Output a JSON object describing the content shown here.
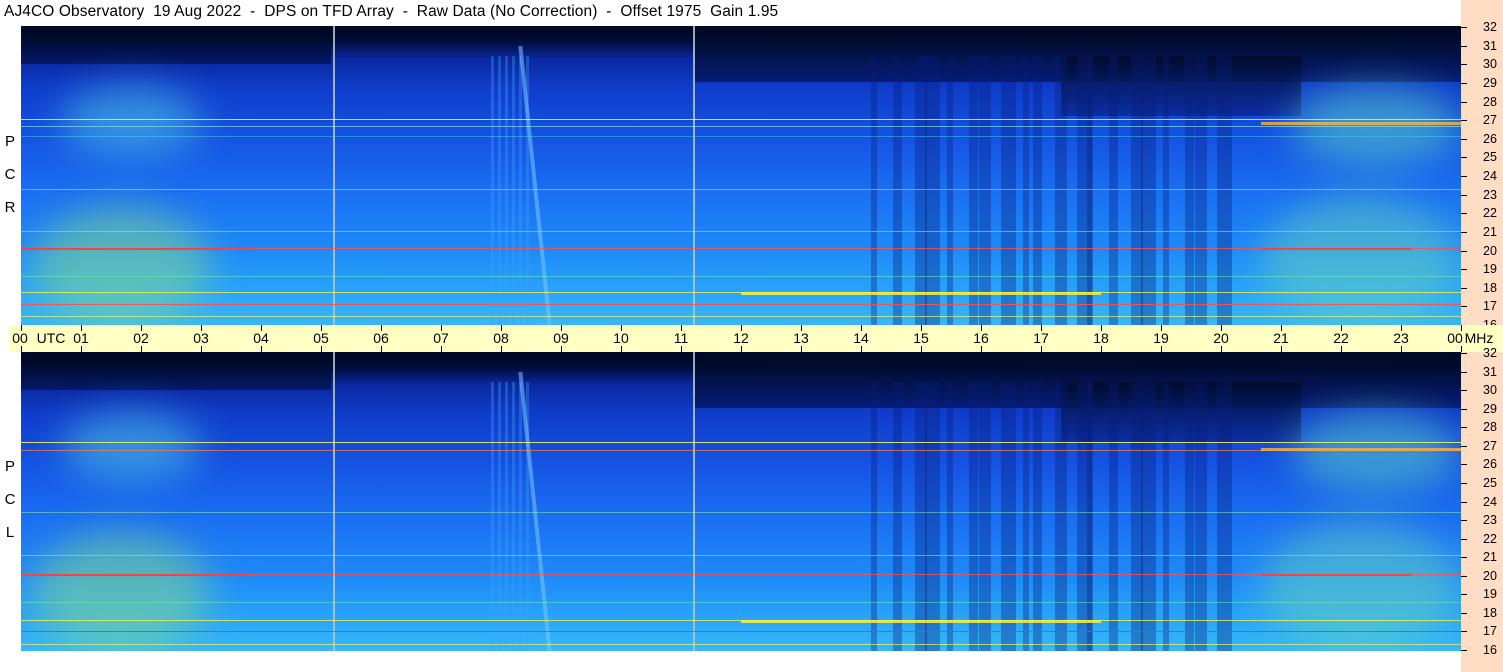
{
  "title": "AJ4CO Observatory  19 Aug 2022  -  DPS on TFD Array  -  Raw Data (No Correction)  -  Offset 1975  Gain 1.95",
  "panels": [
    {
      "label_letters": [
        "R",
        "C",
        "P"
      ]
    },
    {
      "label_letters": [
        "L",
        "C",
        "P"
      ]
    }
  ],
  "frequency_axis": {
    "labels": [
      "32",
      "31",
      "30",
      "29",
      "28",
      "27",
      "26",
      "25",
      "24",
      "23",
      "22",
      "21",
      "20",
      "19",
      "18",
      "17",
      "16"
    ]
  },
  "time_axis": {
    "labels": [
      "00",
      "UTC",
      "01",
      "02",
      "03",
      "04",
      "05",
      "06",
      "07",
      "08",
      "09",
      "10",
      "11",
      "12",
      "13",
      "14",
      "15",
      "16",
      "17",
      "18",
      "19",
      "20",
      "21",
      "22",
      "23",
      "00",
      "MHz"
    ]
  },
  "colors": {
    "background": "#ffffff",
    "time_axis_bg": "#ffffc4",
    "freq_axis_bg": "#ffdcc4",
    "spectrogram_low": "#000820",
    "spectrogram_mid": "#1450e0",
    "spectrogram_high": "#38b8f4"
  }
}
